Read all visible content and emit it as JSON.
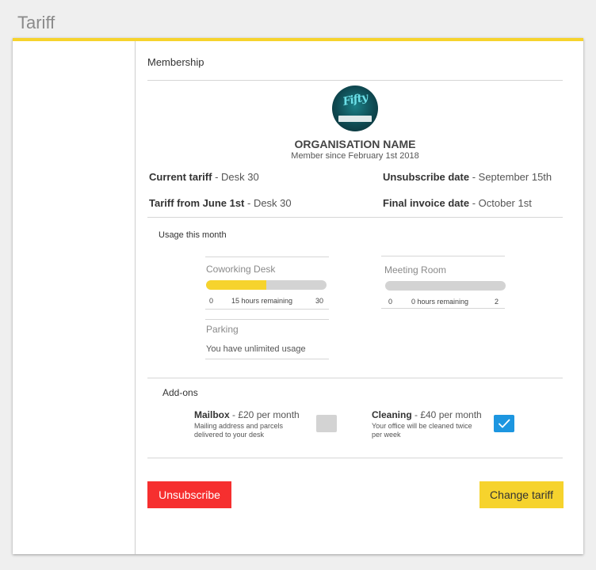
{
  "page": {
    "title": "Tariff"
  },
  "membership": {
    "title": "Membership",
    "org_name": "ORGANISATION NAME",
    "member_since": "Member since February 1st 2018",
    "logo_text": "Fifty",
    "current_tariff": {
      "label": "Current tariff",
      "value": " - Desk 30"
    },
    "tariff_from": {
      "label": "Tariff from June 1st",
      "value": " - Desk 30"
    },
    "unsubscribe_date": {
      "label": "Unsubscribe date",
      "value": " - September 15th"
    },
    "final_invoice": {
      "label": "Final invoice date",
      "value": " - October 1st"
    }
  },
  "usage": {
    "title": "Usage this month",
    "coworking": {
      "label": "Coworking Desk",
      "min": "0",
      "max": "30",
      "remaining": "15 hours remaining",
      "used_fraction": 0.5
    },
    "meeting": {
      "label": "Meeting Room",
      "min": "0",
      "max": "2",
      "remaining": "0 hours remaining",
      "used_fraction": 0
    },
    "parking": {
      "label": "Parking",
      "text": "You have unlimited usage"
    }
  },
  "addons": {
    "title": "Add-ons",
    "mailbox": {
      "name": "Mailbox",
      "price": " - £20 per month",
      "desc": "Mailing address and parcels delivered to your desk",
      "checked": false
    },
    "cleaning": {
      "name": "Cleaning",
      "price": " - £40 per month",
      "desc": "Your office will be cleaned twice per week",
      "checked": true
    }
  },
  "actions": {
    "unsubscribe": "Unsubscribe",
    "change_tariff": "Change tariff"
  },
  "colors": {
    "accent": "#f6d32d",
    "danger": "#f62f2f",
    "checkbox": "#1d96e0"
  }
}
